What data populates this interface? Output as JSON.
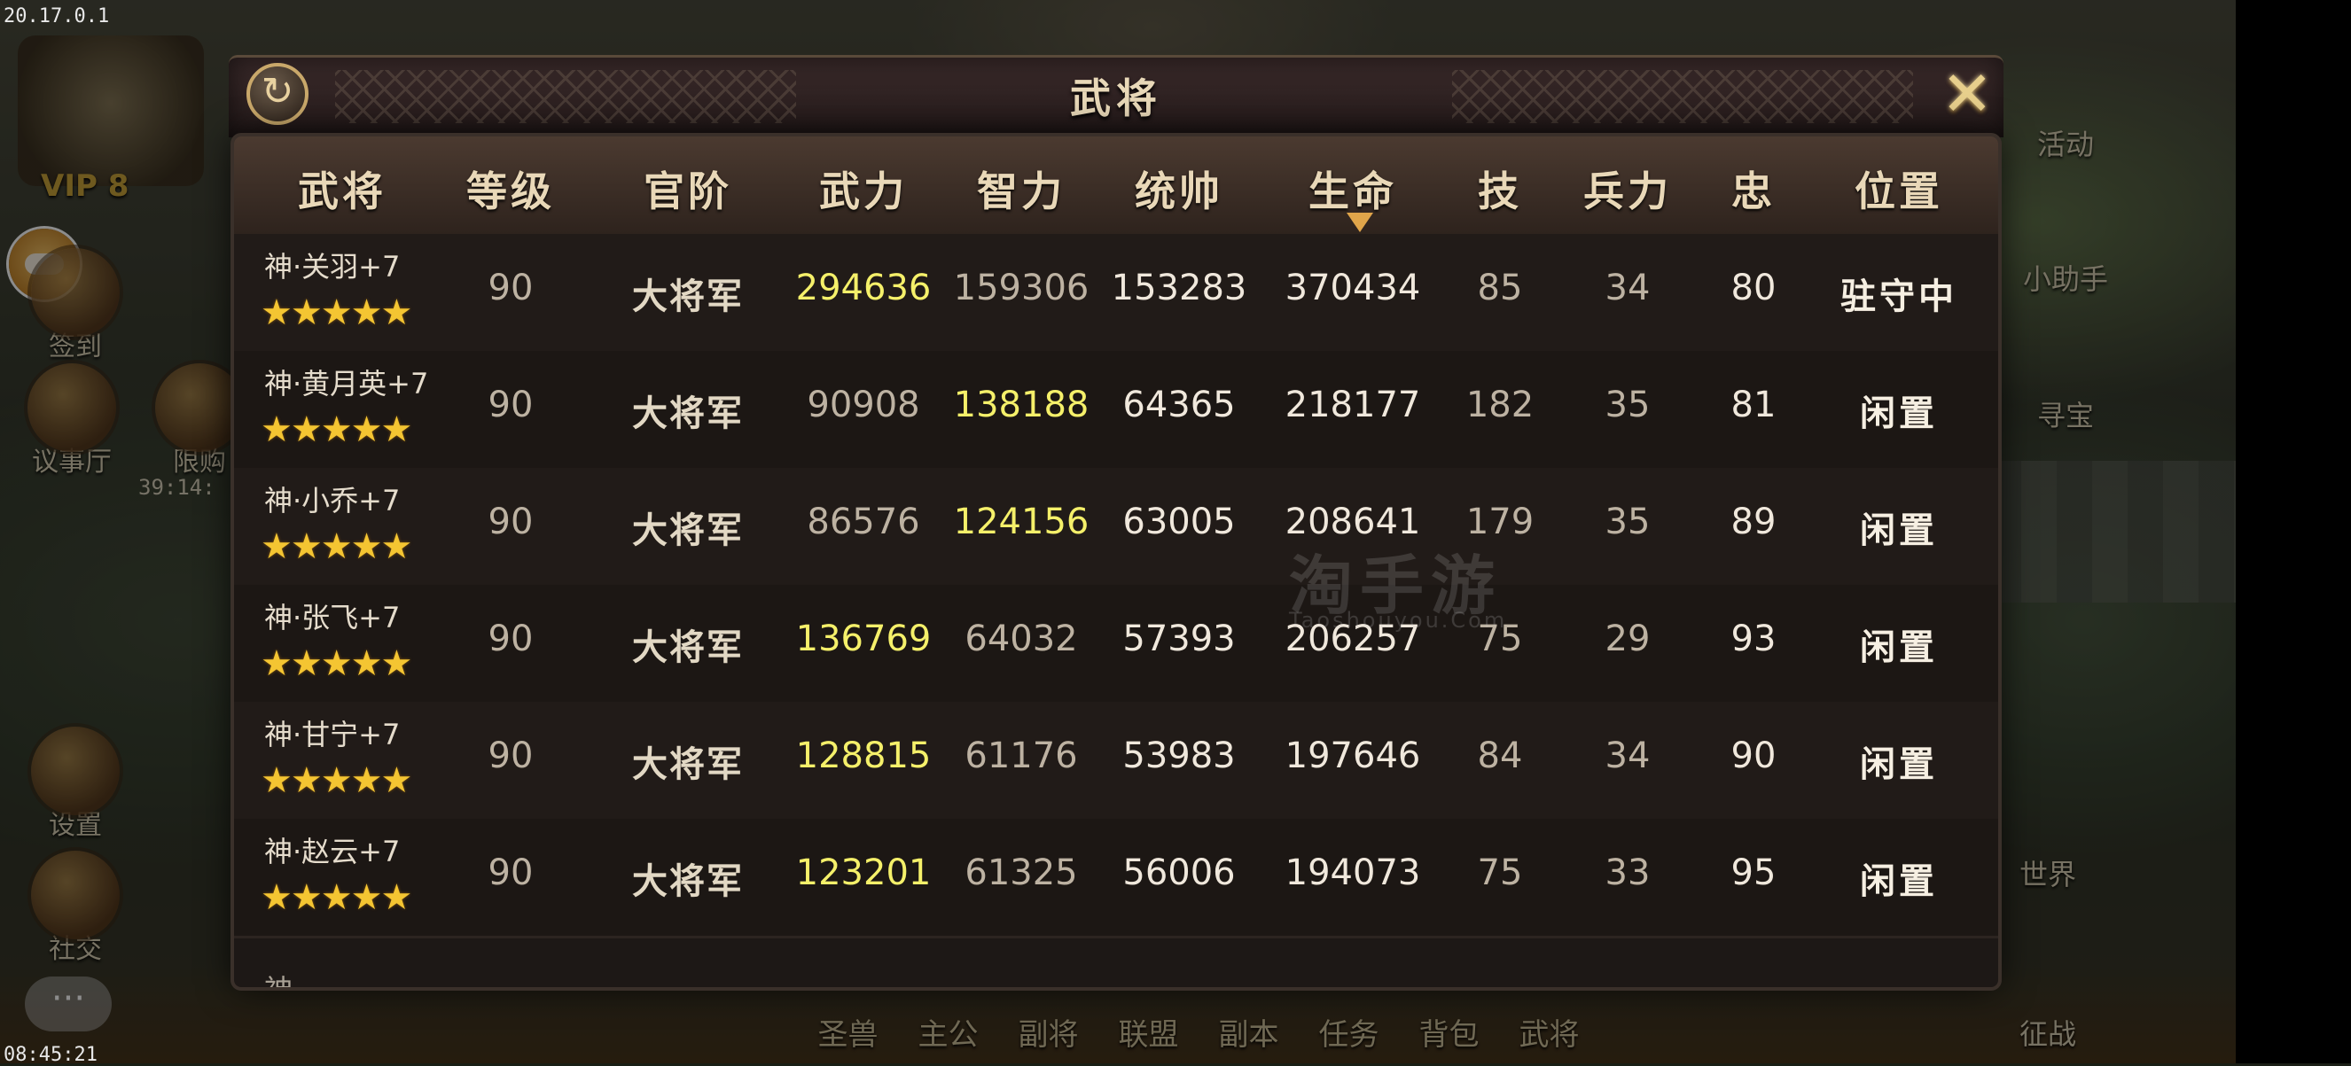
{
  "status": {
    "version": "20.17.0.1",
    "clock": "08:45:21"
  },
  "player": {
    "vip": "VIP 8"
  },
  "left_menu": [
    {
      "label": "签到"
    },
    {
      "label": "议事厅"
    },
    {
      "label": "限购"
    },
    {
      "label": "设置"
    },
    {
      "label": "社交"
    }
  ],
  "limit_timer": "39:14:",
  "right_menu": [
    {
      "label": "活动"
    },
    {
      "label": "小助手"
    },
    {
      "label": "寻宝"
    },
    {
      "label": "世界"
    },
    {
      "label": "征战"
    }
  ],
  "bottom_nav": [
    "圣兽",
    "主公",
    "副将",
    "联盟",
    "副本",
    "任务",
    "背包",
    "武将"
  ],
  "dialog": {
    "title": "武将",
    "refresh_icon": "refresh-icon",
    "close_icon": "close-icon",
    "sort_indicator": "生命 descending",
    "watermark": "淘手游",
    "watermark_url": "Taoshouyou.Com"
  },
  "table": {
    "headers": [
      "武将",
      "等级",
      "官阶",
      "武力",
      "智力",
      "统帅",
      "生命",
      "技",
      "兵力",
      "忠",
      "位置"
    ],
    "rows": [
      {
        "name": "神·关羽+7",
        "stars": "★★★★★",
        "level": "90",
        "rank": "大将军",
        "force": "294636",
        "intellect": "159306",
        "command": "153283",
        "hp": "370434",
        "skill": "85",
        "troops": "34",
        "loyalty": "80",
        "position": "驻守中",
        "highlight": "force"
      },
      {
        "name": "神·黄月英+7",
        "stars": "★★★★★",
        "level": "90",
        "rank": "大将军",
        "force": "90908",
        "intellect": "138188",
        "command": "64365",
        "hp": "218177",
        "skill": "182",
        "troops": "35",
        "loyalty": "81",
        "position": "闲置",
        "highlight": "intellect"
      },
      {
        "name": "神·小乔+7",
        "stars": "★★★★★",
        "level": "90",
        "rank": "大将军",
        "force": "86576",
        "intellect": "124156",
        "command": "63005",
        "hp": "208641",
        "skill": "179",
        "troops": "35",
        "loyalty": "89",
        "position": "闲置",
        "highlight": "intellect"
      },
      {
        "name": "神·张飞+7",
        "stars": "★★★★★",
        "level": "90",
        "rank": "大将军",
        "force": "136769",
        "intellect": "64032",
        "command": "57393",
        "hp": "206257",
        "skill": "75",
        "troops": "29",
        "loyalty": "93",
        "position": "闲置",
        "highlight": "force"
      },
      {
        "name": "神·甘宁+7",
        "stars": "★★★★★",
        "level": "90",
        "rank": "大将军",
        "force": "128815",
        "intellect": "61176",
        "command": "53983",
        "hp": "197646",
        "skill": "84",
        "troops": "34",
        "loyalty": "90",
        "position": "闲置",
        "highlight": "force"
      },
      {
        "name": "神·赵云+7",
        "stars": "★★★★★",
        "level": "90",
        "rank": "大将军",
        "force": "123201",
        "intellect": "61325",
        "command": "56006",
        "hp": "194073",
        "skill": "75",
        "troops": "33",
        "loyalty": "95",
        "position": "闲置",
        "highlight": "force"
      }
    ]
  },
  "colors": {
    "highlight": "#f5f06a",
    "panel": "#1d1816",
    "header": "#4b3a30",
    "gold": "#e7cf8c"
  }
}
